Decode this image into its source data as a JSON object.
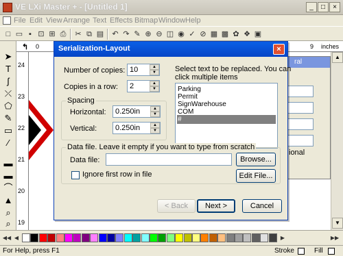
{
  "window": {
    "title": "VE LXi Master + - [Untitled 1]",
    "minimize": "_",
    "maximize": "□",
    "close": "×"
  },
  "menubar": {
    "items": [
      "File",
      "Edit",
      "View",
      "Arrange",
      "Text",
      "Effects",
      "Bitmap",
      "Window",
      "Help"
    ]
  },
  "ruler": {
    "top_unit": "inches",
    "top_marks": [
      "0",
      "9"
    ],
    "left_marks": [
      "24",
      "23",
      "22",
      "21",
      "20",
      "19"
    ]
  },
  "panel": {
    "title_fragment": "ral",
    "side_text": "ional"
  },
  "dialog": {
    "title": "Serialization-Layout",
    "close": "×",
    "number_of_copies_label": "Number of copies:",
    "number_of_copies_value": "10",
    "copies_in_row_label": "Copies in a row:",
    "copies_in_row_value": "2",
    "spacing_label": "Spacing",
    "horizontal_label": "Horizontal:",
    "horizontal_value": "0.250in",
    "vertical_label": "Vertical:",
    "vertical_value": "0.250in",
    "select_text_label_1": "Select text to be replaced. You can",
    "select_text_label_2": "click multiple items",
    "list_items": [
      "Parking",
      "Permit",
      "SignWarehouse",
      "COM",
      "#"
    ],
    "selected_index": 4,
    "data_group_label": "Data file. Leave it empty if you want to type from scratch",
    "data_file_label": "Data file:",
    "data_file_value": "",
    "browse_button": "Browse...",
    "ignore_first_row_label": "Ignore first row in file",
    "ignore_first_row_checked": false,
    "edit_file_button": "Edit File...",
    "back_button": "< Back",
    "next_button": "Next >",
    "cancel_button": "Cancel"
  },
  "palette": {
    "colors": [
      "#ffffff",
      "#000000",
      "#ff0000",
      "#c00000",
      "#ff8080",
      "#ff00ff",
      "#c000c0",
      "#800080",
      "#ff80ff",
      "#0000ff",
      "#0000a0",
      "#8080ff",
      "#00ffff",
      "#00a0a0",
      "#80ffff",
      "#00ff00",
      "#00a000",
      "#80ff80",
      "#ffff00",
      "#c0c000",
      "#ffff80",
      "#ff8000",
      "#c06000",
      "#ffc080",
      "#808080",
      "#a0a0a0",
      "#c0c0c0",
      "#606060",
      "#e0e0e0",
      "#404040"
    ]
  },
  "status": {
    "help_text": "For Help, press F1",
    "stroke_label": "Stroke",
    "fill_label": "Fill"
  }
}
